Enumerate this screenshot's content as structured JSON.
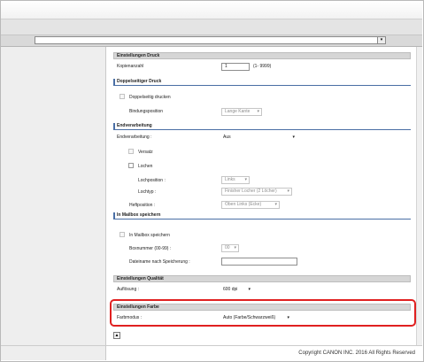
{
  "header": {
    "select_arrow": "▾"
  },
  "sections": {
    "print_settings": {
      "title": "Einstellungen Druck",
      "copies_label": "Kopienanzahl",
      "copies_value": "1",
      "copies_range": "(1- 9999)"
    },
    "duplex": {
      "title": "Doppelseitiger Druck",
      "duplex_label": "Doppelseitig drucken",
      "binding_label": "Bindungsposition",
      "binding_value": "Lange Kante"
    },
    "finishing": {
      "title": "Endverarbeitung",
      "finishing_label": "Endverarbeitung :",
      "finishing_value": "Aus",
      "offset_label": "Versatz",
      "punch_label": "Lochen",
      "punch_position_label": "Lochposition :",
      "punch_position_value": "Links",
      "punch_type_label": "Lochtyp :",
      "punch_type_value": "Finisher Locher (2 Löcher)",
      "staple_label": "Heftposition :",
      "staple_value": "Oben Links (Ecke)"
    },
    "mailbox": {
      "title": "In Mailbox speichern",
      "save_label": "In Mailbox speichern",
      "box_number_label": "Boxnummer (00-99) :",
      "box_number_value": "00",
      "filename_label": "Dateiname nach Speicherung :",
      "filename_value": ""
    },
    "quality": {
      "title": "Einstellungen Qualität",
      "resolution_label": "Auflösung :",
      "resolution_value": "600 dpi"
    },
    "color": {
      "title": "Einstellungen Farbe",
      "color_mode_label": "Farbmodus :",
      "color_mode_value": "Auto (Farbe/Schwarzweiß)"
    }
  },
  "dropdown_arrow": "▾",
  "scroll_top_icon": "▲",
  "footer": {
    "copyright": "Copyright CANON INC. 2016 All Rights Reserved"
  },
  "colors": {
    "highlight": "#e02020",
    "section_accent": "#4a6fa5"
  }
}
